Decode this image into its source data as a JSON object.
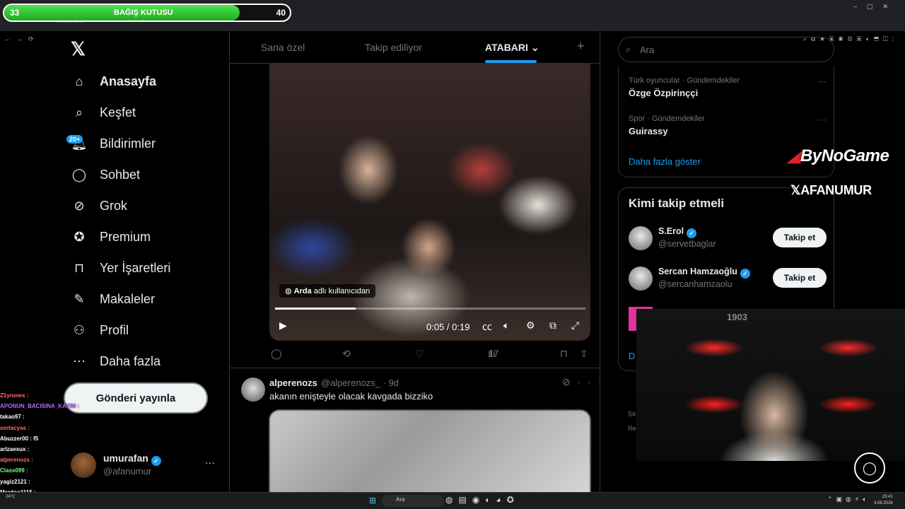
{
  "browser": {
    "url": "x.com/home"
  },
  "donation": {
    "title": "BAĞIŞ KUTUSU",
    "current": "33",
    "goal": "40",
    "progress": 0.825
  },
  "sidebar": {
    "items": [
      {
        "label": "Anasayfa",
        "icon": "home-icon"
      },
      {
        "label": "Keşfet",
        "icon": "search-icon"
      },
      {
        "label": "Bildirimler",
        "icon": "bell-icon",
        "badge": "20+"
      },
      {
        "label": "Sohbet",
        "icon": "chat-icon"
      },
      {
        "label": "Grok",
        "icon": "grok-icon"
      },
      {
        "label": "Premium",
        "icon": "premium-icon"
      },
      {
        "label": "Yer İşaretleri",
        "icon": "bookmark-icon"
      },
      {
        "label": "Makaleler",
        "icon": "articles-icon"
      },
      {
        "label": "Profil",
        "icon": "profile-icon"
      },
      {
        "label": "Daha fazla",
        "icon": "more-circle-icon"
      }
    ],
    "post_button": "Gönderi yayınla",
    "account": {
      "name": "umurafan",
      "handle": "@afanumur"
    }
  },
  "main": {
    "tabs": [
      {
        "label": "Sana özel"
      },
      {
        "label": "Takip ediliyor"
      },
      {
        "label": "ATABARI"
      }
    ],
    "video": {
      "credit_name": "Arda",
      "credit_suffix": " adlı kullanıcıdan",
      "time": "0:05 / 0:19",
      "progress": 0.26
    },
    "actions": {
      "views": "17"
    },
    "tweet2": {
      "name": "alperenozs",
      "handle": "@alperenozs_ · 9d",
      "text": "akanın enişteyle olacak kavgada bizziko"
    }
  },
  "right": {
    "search_placeholder": "Ara",
    "trends": [
      {
        "category": "Türk oyuncular · Gündemdekiler",
        "title": "Özge Özpirinççi"
      },
      {
        "category": "Spor · Gündemdekiler",
        "title": "Guirassy"
      }
    ],
    "show_more": "Daha fazla göster",
    "who_to_follow": {
      "title": "Kimi takip etmeli",
      "people": [
        {
          "name": "S.Erol",
          "handle": "@servetbaglar",
          "button": "Takip et"
        },
        {
          "name": "Sercan Hamzaoğlu",
          "handle": "@sercanhamzaolu",
          "button": "Takip et"
        }
      ],
      "partial": "D"
    },
    "footer_bits": [
      "Şa",
      "Re"
    ]
  },
  "overlay": {
    "brand1": "ByNoGame",
    "brand2": "AFANUMUR",
    "webcam_sign": "1903"
  },
  "chat": [
    {
      "user": "Z1yronex :",
      "color": "#ff6b6b"
    },
    {
      "user": "APONUN_BACISINA_KAYIM :",
      "color": "#b06bff"
    },
    {
      "user": "takao97 :",
      "color": "#ffffff"
    },
    {
      "user": "sertacyas :",
      "color": "#ff6b6b"
    },
    {
      "user": "Abuzzer00 : f5",
      "color": "#ffffff"
    },
    {
      "user": "arlzaexux :",
      "color": "#ffffff"
    },
    {
      "user": "alperenozs :",
      "color": "#ff6b6b"
    },
    {
      "user": "Class099 :",
      "color": "#7dff7d"
    },
    {
      "user": "yagiz2121 :",
      "color": "#ffffff"
    },
    {
      "user": "Merdoo1115 :",
      "color": "#ffffff"
    }
  ],
  "taskbar": {
    "search": "Ara",
    "time": "23:41",
    "date": "3.08.2026",
    "weather": "24°C"
  }
}
